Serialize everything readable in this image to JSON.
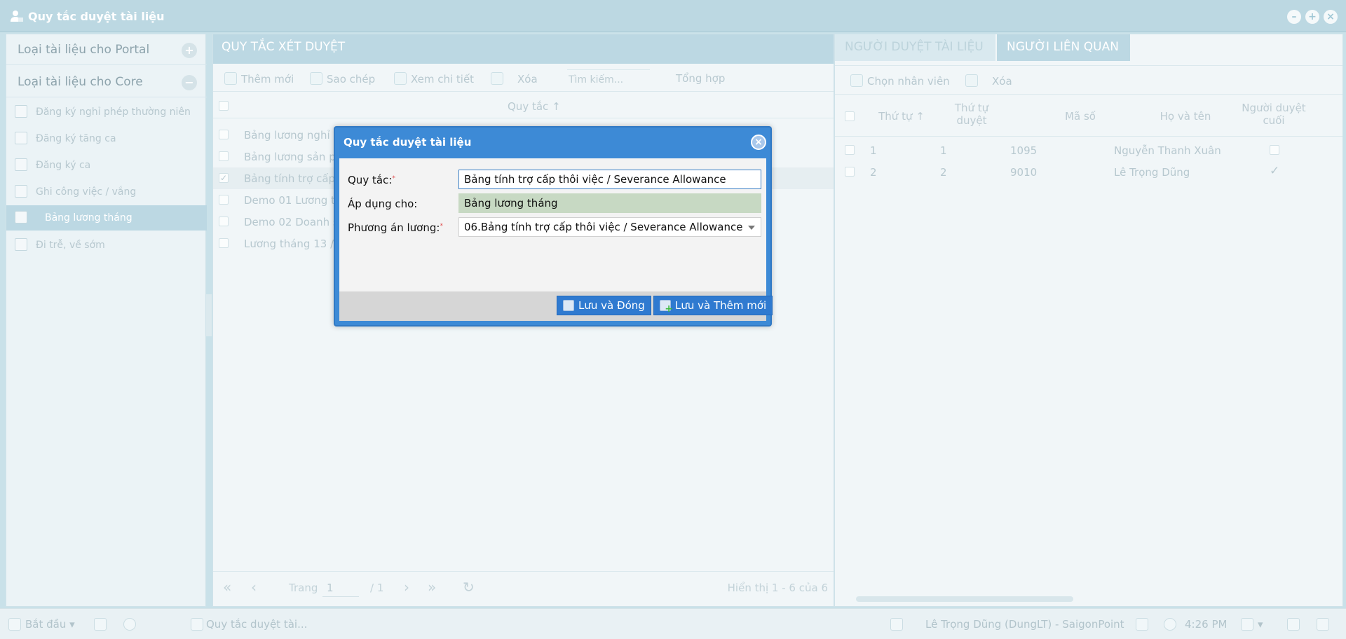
{
  "window": {
    "title": "Quy tắc duyệt tài liệu",
    "min_icon": "minimize-icon",
    "max_icon": "maximize-icon",
    "close_icon": "close-icon"
  },
  "left": {
    "sections": [
      {
        "label": "Loại tài liệu cho Portal",
        "toggle": "+"
      },
      {
        "label": "Loại tài liệu cho Core",
        "toggle": "−"
      }
    ],
    "items": [
      {
        "label": "Đăng ký nghỉ phép thường niên"
      },
      {
        "label": "Đăng ký tăng ca"
      },
      {
        "label": "Đăng ký ca"
      },
      {
        "label": "Ghi công việc / vắng"
      },
      {
        "label": "Bảng lương tháng"
      },
      {
        "label": "Đi trễ, về sớm"
      }
    ]
  },
  "center": {
    "header": "QUY TẮC XÉT DUYỆT",
    "toolbar": {
      "add": "Thêm mới",
      "copy": "Sao chép",
      "detail": "Xem chi tiết",
      "delete": "Xóa",
      "search_placeholder": "Tìm kiếm...",
      "summary": "Tổng hợp"
    },
    "column": "Quy tắc",
    "rows": [
      "Bảng lương nghỉ v",
      "Bảng lương sản p",
      "Bảng tính trợ cấp",
      "Demo 01 Lương t",
      "Demo 02 Doanh s",
      "Lương tháng 13 /"
    ],
    "pager": {
      "page_label": "Trang",
      "page_value": "1",
      "of_pages": "/ 1",
      "display": "Hiển thị 1 - 6 của 6"
    }
  },
  "right": {
    "tabs": [
      "NGƯỜI DUYỆT TÀI LIỆU",
      "NGƯỜI LIÊN QUAN"
    ],
    "toolbar": {
      "choose": "Chọn nhân viên",
      "delete": "Xóa"
    },
    "columns": {
      "order": "Thứ tự",
      "approve_order": "Thứ tự duyệt",
      "code": "Mã số",
      "name": "Họ và tên",
      "final": "Người duyệt cuối"
    },
    "rows": [
      {
        "order": "1",
        "approve_order": "1",
        "code": "1095",
        "name": "Nguyễn Thanh Xuân",
        "final": ""
      },
      {
        "order": "2",
        "approve_order": "2",
        "code": "9010",
        "name": "Lê Trọng Dũng",
        "final": "✓"
      }
    ]
  },
  "taskbar": {
    "start": "Bắt đầu",
    "task": "Quy tắc duyệt tài...",
    "user": "Lê Trọng Dũng (DungLT) - SaigonPoint",
    "time": "4:26 PM"
  },
  "dialog": {
    "title": "Quy tắc duyệt tài liệu",
    "fields": {
      "rule_label": "Quy tắc:",
      "rule_value": "Bảng tính trợ cấp thôi việc / Severance Allowance",
      "apply_label": "Áp dụng cho:",
      "apply_value": "Bảng lương tháng",
      "plan_label": "Phương án lương:",
      "plan_value": "06.Bảng tính trợ cấp thôi việc / Severance Allowance"
    },
    "buttons": {
      "save_close": "Lưu và Đóng",
      "save_new": "Lưu và Thêm mới"
    }
  },
  "colors": {
    "accent": "#3d8ad6",
    "header_bg": "#bcd8e3",
    "readonly_bg": "#c7d9c3"
  }
}
